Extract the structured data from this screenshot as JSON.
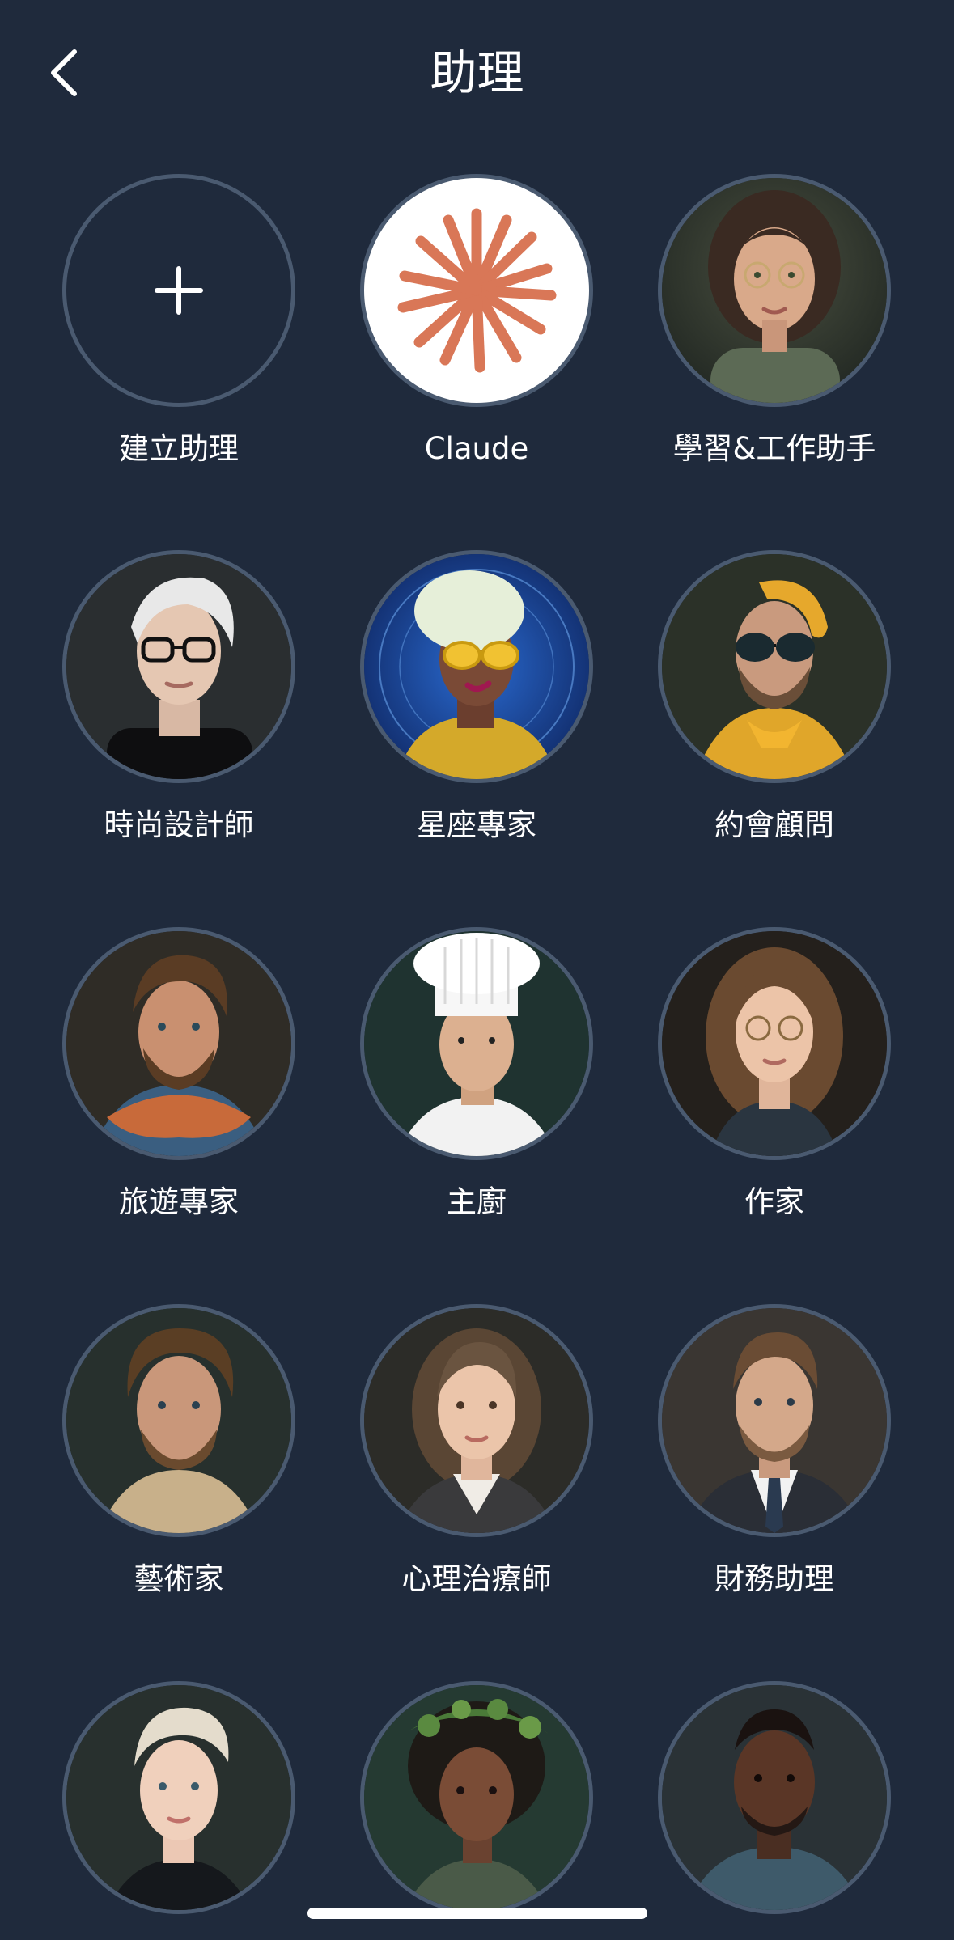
{
  "header": {
    "title": "助理"
  },
  "icons": {
    "back": "chevron-left-icon",
    "add": "plus-icon",
    "claude": "claude-sparkle-logo"
  },
  "colors": {
    "background": "#1f2a3c",
    "avatar_border": "#4a5a70",
    "claude_orange": "#d97757"
  },
  "assistants": [
    {
      "label": "建立助理"
    },
    {
      "label": "Claude"
    },
    {
      "label": "學習&工作助手"
    },
    {
      "label": "時尚設計師"
    },
    {
      "label": "星座專家"
    },
    {
      "label": "約會顧問"
    },
    {
      "label": "旅遊專家"
    },
    {
      "label": "主廚"
    },
    {
      "label": "作家"
    },
    {
      "label": "藝術家"
    },
    {
      "label": "心理治療師"
    },
    {
      "label": "財務助理"
    },
    {
      "label": ""
    },
    {
      "label": ""
    },
    {
      "label": ""
    }
  ]
}
